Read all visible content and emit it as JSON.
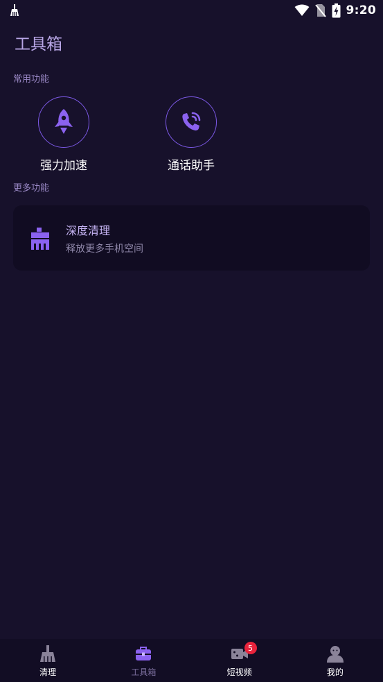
{
  "status_bar": {
    "time": "9:20",
    "icons": [
      "cleaner-icon",
      "wifi-icon",
      "no-sim-icon",
      "battery-charging-icon"
    ]
  },
  "page": {
    "title": "工具箱"
  },
  "common_section": {
    "label": "常用功能",
    "tools": [
      {
        "label": "强力加速",
        "icon": "rocket-icon"
      },
      {
        "label": "通话助手",
        "icon": "phone-call-icon"
      }
    ]
  },
  "more_section": {
    "label": "更多功能",
    "items": [
      {
        "title": "深度清理",
        "subtitle": "释放更多手机空间",
        "icon": "broom-icon"
      }
    ]
  },
  "bottom_nav": {
    "items": [
      {
        "label": "清理",
        "icon": "broom-icon",
        "active": false
      },
      {
        "label": "工具箱",
        "icon": "toolbox-icon",
        "active": true
      },
      {
        "label": "短视频",
        "icon": "video-icon",
        "active": false,
        "badge": "5"
      },
      {
        "label": "我的",
        "icon": "user-icon",
        "active": false
      }
    ]
  },
  "colors": {
    "background": "#17112b",
    "accent": "#7c59e6",
    "card": "#110c22",
    "badge": "#e8233c"
  }
}
